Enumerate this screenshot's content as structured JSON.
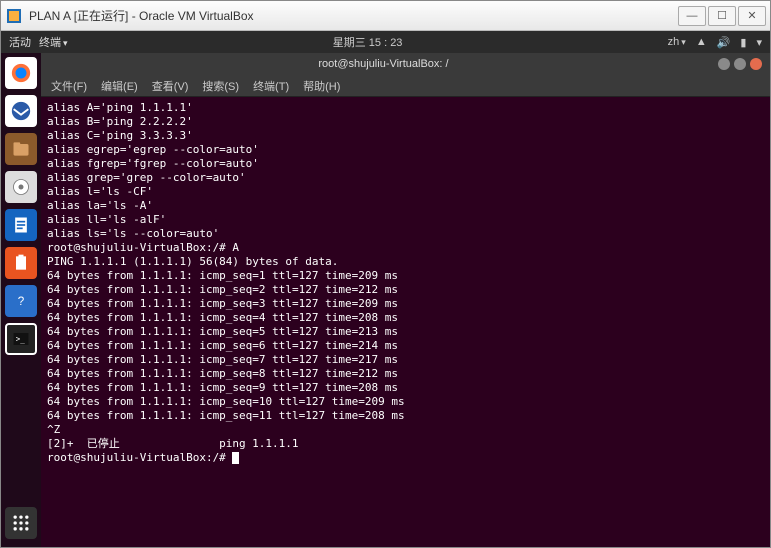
{
  "window": {
    "title": "PLAN A [正在运行] - Oracle VM VirtualBox"
  },
  "topbar": {
    "activities": "活动",
    "terminal_menu": "终端",
    "clock": "星期三 15 : 23",
    "lang": "zh"
  },
  "term": {
    "title": "root@shujuliu-VirtualBox: /",
    "menus": {
      "file": "文件(F)",
      "edit": "编辑(E)",
      "view": "查看(V)",
      "search": "搜索(S)",
      "terminal": "终端(T)",
      "help": "帮助(H)"
    }
  },
  "lines": [
    "alias A='ping 1.1.1.1'",
    "alias B='ping 2.2.2.2'",
    "alias C='ping 3.3.3.3'",
    "alias egrep='egrep --color=auto'",
    "alias fgrep='fgrep --color=auto'",
    "alias grep='grep --color=auto'",
    "alias l='ls -CF'",
    "alias la='ls -A'",
    "alias ll='ls -alF'",
    "alias ls='ls --color=auto'",
    "root@shujuliu-VirtualBox:/# A",
    "PING 1.1.1.1 (1.1.1.1) 56(84) bytes of data.",
    "64 bytes from 1.1.1.1: icmp_seq=1 ttl=127 time=209 ms",
    "64 bytes from 1.1.1.1: icmp_seq=2 ttl=127 time=212 ms",
    "64 bytes from 1.1.1.1: icmp_seq=3 ttl=127 time=209 ms",
    "64 bytes from 1.1.1.1: icmp_seq=4 ttl=127 time=208 ms",
    "",
    "64 bytes from 1.1.1.1: icmp_seq=5 ttl=127 time=213 ms",
    "64 bytes from 1.1.1.1: icmp_seq=6 ttl=127 time=214 ms",
    "64 bytes from 1.1.1.1: icmp_seq=7 ttl=127 time=217 ms",
    "64 bytes from 1.1.1.1: icmp_seq=8 ttl=127 time=212 ms",
    "",
    "",
    "",
    "",
    "64 bytes from 1.1.1.1: icmp_seq=9 ttl=127 time=208 ms",
    "64 bytes from 1.1.1.1: icmp_seq=10 ttl=127 time=209 ms",
    "64 bytes from 1.1.1.1: icmp_seq=11 ttl=127 time=208 ms",
    "^Z",
    "[2]+  已停止               ping 1.1.1.1",
    "root@shujuliu-VirtualBox:/# "
  ],
  "colors": {
    "term_bg": "#2c001e",
    "accent_orange": "#e95420",
    "close_red": "#e46c4e",
    "min_grey": "#8a8a8a",
    "max_grey": "#8a8a8a"
  }
}
